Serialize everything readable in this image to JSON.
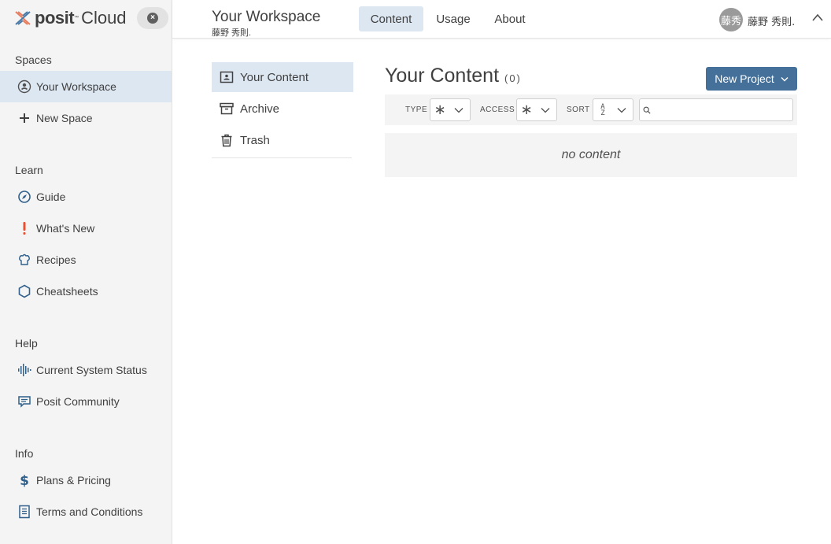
{
  "brand": {
    "name_bold": "posit",
    "trademark": "™",
    "name_light": "Cloud",
    "close_glyph": "×"
  },
  "sidebar": {
    "sections": [
      {
        "title": "Spaces",
        "items": [
          {
            "label": "Your Workspace",
            "icon": "user-circle-icon",
            "active": true
          },
          {
            "label": "New Space",
            "icon": "plus-icon",
            "active": false
          }
        ]
      },
      {
        "title": "Learn",
        "items": [
          {
            "label": "Guide",
            "icon": "compass-icon"
          },
          {
            "label": "What's New",
            "icon": "exclamation-icon"
          },
          {
            "label": "Recipes",
            "icon": "chef-hat-icon"
          },
          {
            "label": "Cheatsheets",
            "icon": "hexagon-icon"
          }
        ]
      },
      {
        "title": "Help",
        "items": [
          {
            "label": "Current System Status",
            "icon": "pulse-bars-icon"
          },
          {
            "label": "Posit Community",
            "icon": "chat-bubble-icon"
          }
        ]
      },
      {
        "title": "Info",
        "items": [
          {
            "label": "Plans & Pricing",
            "icon": "dollar-icon"
          },
          {
            "label": "Terms and Conditions",
            "icon": "document-icon"
          }
        ]
      }
    ]
  },
  "header": {
    "workspace_title": "Your Workspace",
    "workspace_owner": "藤野 秀則.",
    "tabs": [
      {
        "label": "Content",
        "active": true
      },
      {
        "label": "Usage",
        "active": false
      },
      {
        "label": "About",
        "active": false
      }
    ],
    "user": {
      "avatar_text": "藤秀",
      "name": "藤野 秀則."
    }
  },
  "content_nav": {
    "items": [
      {
        "label": "Your Content",
        "icon": "content-box-icon",
        "active": true
      },
      {
        "label": "Archive",
        "icon": "archive-icon",
        "active": false
      },
      {
        "label": "Trash",
        "icon": "trash-icon",
        "active": false
      }
    ]
  },
  "main": {
    "title": "Your Content",
    "count": "(0)",
    "new_project_label": "New Project",
    "filters": {
      "type_label": "TYPE",
      "type_value": "∗",
      "access_label": "ACCESS",
      "access_value": "∗",
      "sort_label": "SORT",
      "sort_value_top": "A",
      "sort_value_bottom": "Z",
      "search_placeholder": ""
    },
    "empty_text": "no content"
  },
  "colors": {
    "accent": "#447099",
    "active_bg": "#dde7f2",
    "sidebar_bg": "#f4f4f4",
    "whats_new_icon": "#e8502f"
  }
}
